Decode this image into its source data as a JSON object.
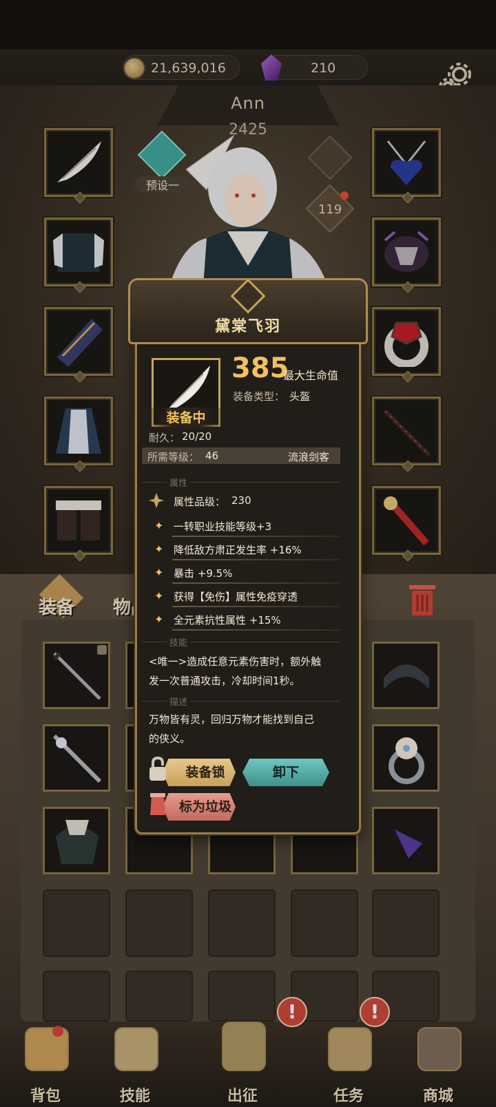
{
  "resources": {
    "gold": "21,639,016",
    "gems": "210"
  },
  "character": {
    "name": "Ann",
    "power": "2425",
    "preset_label": "预设一",
    "badge_count": "119"
  },
  "tabs": {
    "equip": "装备",
    "items": "物品"
  },
  "nav": [
    {
      "label": "背包",
      "icon": "backpack-icon"
    },
    {
      "label": "技能",
      "icon": "skill-book-icon"
    },
    {
      "label": "出征",
      "icon": "sword-map-icon"
    },
    {
      "label": "任务",
      "icon": "scroll-icon"
    },
    {
      "label": "商城",
      "icon": "shop-icon"
    }
  ],
  "tooltip": {
    "title": "黛棠飞羽",
    "equipped_label": "装备中",
    "main_value": "385",
    "main_stat": "最大生命值",
    "type_label": "装备类型：",
    "type_value": "头盔",
    "durability_label": "耐久：",
    "durability_value": "20/20",
    "level_req_label": "所需等级：",
    "level_req_value": "46",
    "class_req": "流浪剑客",
    "section_attr": "属性",
    "attr_quality_label": "属性品级：",
    "attr_quality_value": "230",
    "attributes": [
      "一转职业技能等级+3",
      "降低敌方肃正发生率 +16%",
      "暴击 +9.5%",
      "获得【免伤】属性免疫穿透",
      "全元素抗性属性 +15%"
    ],
    "section_skill": "技能",
    "skill_text_1": "<唯一>造成任意元素伤害时，额外触",
    "skill_text_2": "发一次普通攻击，冷却时间1秒。",
    "section_desc": "描述",
    "desc_text_1": "万物皆有灵，回归万物才能找到自己",
    "desc_text_2": "的侠义。",
    "btn_lock": "装备锁",
    "btn_unequip": "卸下",
    "btn_trash": "标为垃圾"
  },
  "colors": {
    "gold_accent": "#f2c060",
    "frame": "#8a7446",
    "unequip_btn": "#4fa9a3",
    "alert": "#c8463a"
  }
}
